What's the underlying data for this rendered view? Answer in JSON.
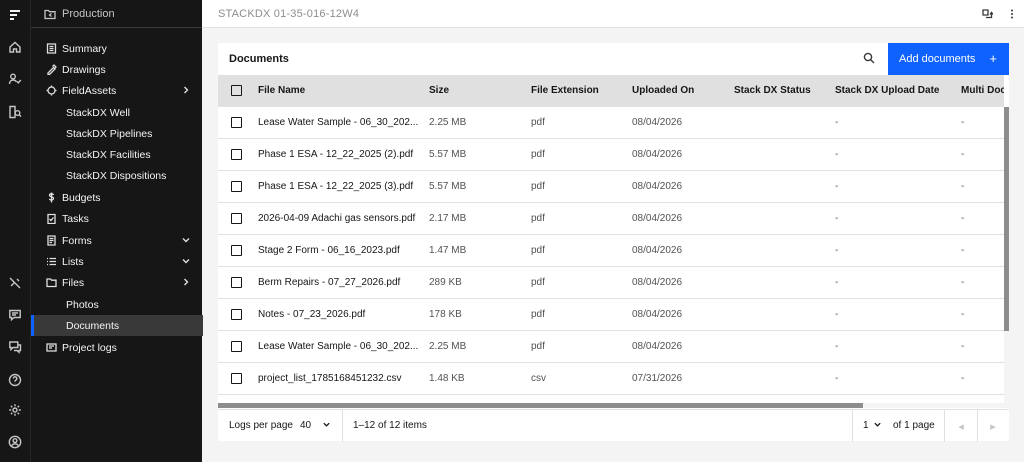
{
  "sidebar": {
    "header": "Production",
    "items": [
      {
        "label": "Summary"
      },
      {
        "label": "Drawings"
      },
      {
        "label": "FieldAssets"
      },
      {
        "label": "StackDX Well"
      },
      {
        "label": "StackDX Pipelines"
      },
      {
        "label": "StackDX Facilities"
      },
      {
        "label": "StackDX Dispositions"
      },
      {
        "label": "Budgets"
      },
      {
        "label": "Tasks"
      },
      {
        "label": "Forms"
      },
      {
        "label": "Lists"
      },
      {
        "label": "Files"
      },
      {
        "label": "Photos"
      },
      {
        "label": "Documents"
      },
      {
        "label": "Project logs"
      }
    ]
  },
  "topbar": {
    "title": "STACKDX 01-35-016-12W4"
  },
  "card": {
    "title": "Documents",
    "add_label": "Add documents",
    "add_plus": "+"
  },
  "table": {
    "columns": [
      "File Name",
      "Size",
      "File Extension",
      "Uploaded On",
      "Stack DX Status",
      "Stack DX Upload Date",
      "Multi Docu"
    ],
    "rows": [
      {
        "name": "Lease Water Sample - 06_30_202...",
        "size": "2.25 MB",
        "ext": "pdf",
        "uploaded": "08/04/2026",
        "status": "",
        "upload_date": "-",
        "multi": "-"
      },
      {
        "name": "Phase 1 ESA - 12_22_2025 (2).pdf",
        "size": "5.57 MB",
        "ext": "pdf",
        "uploaded": "08/04/2026",
        "status": "",
        "upload_date": "-",
        "multi": "-"
      },
      {
        "name": "Phase 1 ESA - 12_22_2025 (3).pdf",
        "size": "5.57 MB",
        "ext": "pdf",
        "uploaded": "08/04/2026",
        "status": "",
        "upload_date": "-",
        "multi": "-"
      },
      {
        "name": "2026-04-09 Adachi gas sensors.pdf",
        "size": "2.17 MB",
        "ext": "pdf",
        "uploaded": "08/04/2026",
        "status": "",
        "upload_date": "-",
        "multi": "-"
      },
      {
        "name": "Stage 2 Form - 06_16_2023.pdf",
        "size": "1.47 MB",
        "ext": "pdf",
        "uploaded": "08/04/2026",
        "status": "",
        "upload_date": "-",
        "multi": "-"
      },
      {
        "name": "Berm Repairs - 07_27_2026.pdf",
        "size": "289 KB",
        "ext": "pdf",
        "uploaded": "08/04/2026",
        "status": "",
        "upload_date": "-",
        "multi": "-"
      },
      {
        "name": "Notes - 07_23_2026.pdf",
        "size": "178 KB",
        "ext": "pdf",
        "uploaded": "08/04/2026",
        "status": "",
        "upload_date": "-",
        "multi": "-"
      },
      {
        "name": "Lease Water Sample - 06_30_202...",
        "size": "2.25 MB",
        "ext": "pdf",
        "uploaded": "08/04/2026",
        "status": "",
        "upload_date": "-",
        "multi": "-"
      },
      {
        "name": "project_list_1785168451232.csv",
        "size": "1.48 KB",
        "ext": "csv",
        "uploaded": "07/31/2026",
        "status": "",
        "upload_date": "-",
        "multi": "-"
      }
    ]
  },
  "pager": {
    "per_page_label": "Logs per page",
    "per_page_value": "40",
    "range": "1–12 of 12 items",
    "page_value": "1",
    "of_pages": "of 1 page",
    "prev": "◂",
    "next": "▸"
  },
  "colors": {
    "accent": "#0f62fe",
    "sidebar_bg": "#161616",
    "header_bg": "#e0e0e0"
  }
}
